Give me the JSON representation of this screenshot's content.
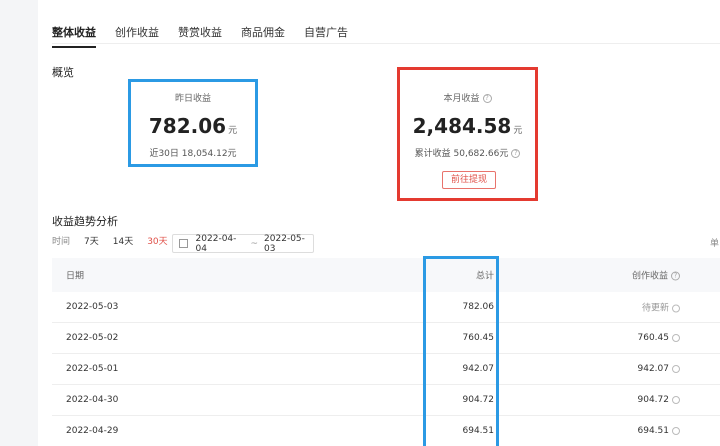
{
  "tabs": [
    "整体收益",
    "创作收益",
    "赞赏收益",
    "商品佣金",
    "自营广告"
  ],
  "overview": {
    "title": "概览",
    "yesterday": {
      "label": "昨日收益",
      "value": "782.06",
      "unit": "元",
      "sub": "近30日 18,054.12元"
    },
    "month": {
      "label": "本月收益",
      "value": "2,484.58",
      "unit": "元",
      "sub": "累计收益 50,682.66元",
      "button": "前往提现"
    }
  },
  "trend": {
    "title": "收益趋势分析",
    "time_label": "时间",
    "options": [
      "7天",
      "14天",
      "30天"
    ],
    "active_option": "30天",
    "date_start": "2022-04-04",
    "date_sep": "~",
    "date_end": "2022-05-03",
    "right_cut": "单"
  },
  "table": {
    "headers": {
      "date": "日期",
      "total": "总计",
      "create": "创作收益"
    },
    "rows": [
      {
        "date": "2022-05-03",
        "total": "782.06",
        "create": "待更新"
      },
      {
        "date": "2022-05-02",
        "total": "760.45",
        "create": "760.45"
      },
      {
        "date": "2022-05-01",
        "total": "942.07",
        "create": "942.07"
      },
      {
        "date": "2022-04-30",
        "total": "904.72",
        "create": "904.72"
      },
      {
        "date": "2022-04-29",
        "total": "694.51",
        "create": "694.51"
      }
    ]
  },
  "colors": {
    "highlight_blue": "#2b9ae4",
    "highlight_red": "#e43a30",
    "accent": "#e0524a"
  }
}
